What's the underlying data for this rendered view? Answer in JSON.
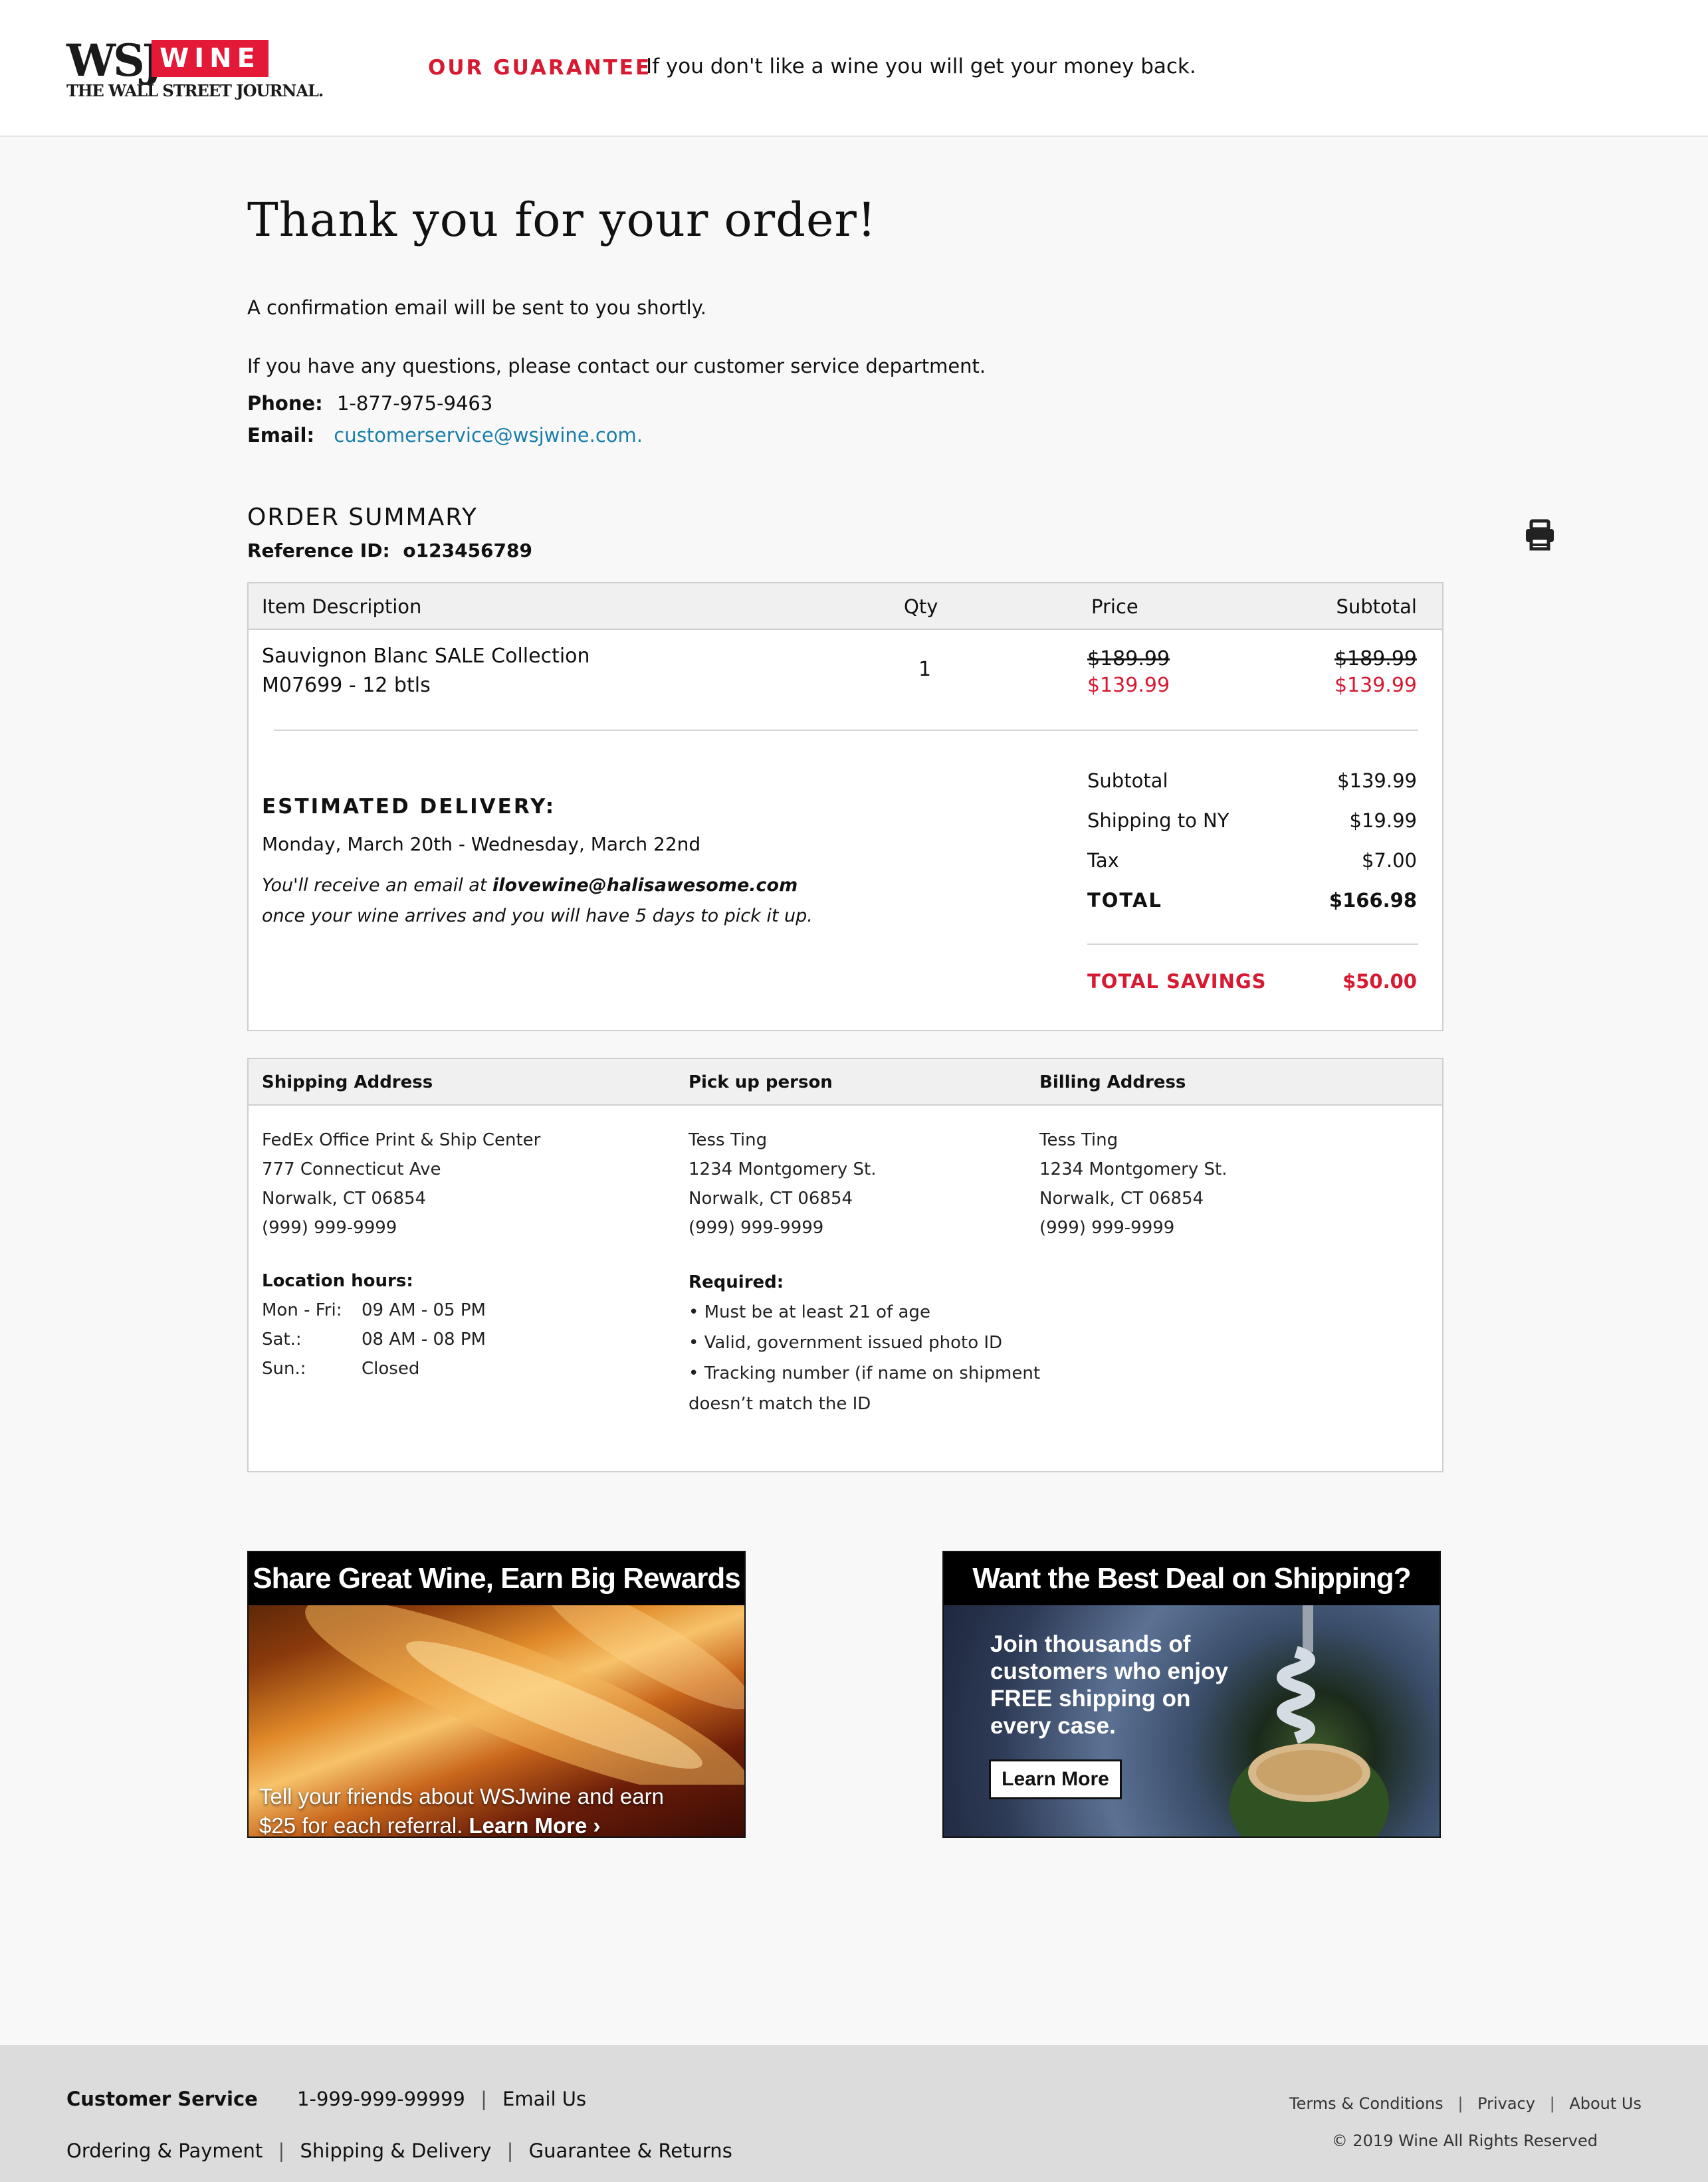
{
  "header": {
    "logo_wsj": "WSJ",
    "logo_wine": "WINE",
    "logo_journal": "THE WALL STREET JOURNAL.",
    "guarantee_label": "OUR GUARANTEE",
    "guarantee_text": "If you don't like a wine you will get your money back."
  },
  "intro": {
    "title": "Thank you for your order!",
    "confirmation": "A confirmation email will be sent to you shortly.",
    "questions": "If you have any questions, please contact our customer service department.",
    "phone_label": "Phone:",
    "phone": "1-877-975-9463",
    "email_label": "Email:",
    "email": "customerservice@wsjwine.com."
  },
  "summary": {
    "title": "ORDER SUMMARY",
    "reference_label": "Reference ID:",
    "reference_id": "o123456789",
    "print_icon": "printer-icon",
    "columns": {
      "description": "Item Description",
      "qty": "Qty",
      "price": "Price",
      "subtotal": "Subtotal"
    },
    "item": {
      "name": "Sauvignon Blanc SALE Collection",
      "code": "M07699 - 12 btls",
      "qty": "1",
      "price_original": "$189.99",
      "price_sale": "$139.99",
      "subtotal_original": "$189.99",
      "subtotal_sale": "$139.99"
    },
    "delivery": {
      "title": "ESTIMATED DELIVERY:",
      "dates": "Monday, March 20th - Wednesday, March 22nd",
      "note_before": "You'll receive an email at ",
      "note_email": "ilovewine@halisawesome.com",
      "note_after": " once your wine arrives and you will have 5 days to pick it up."
    },
    "totals": {
      "subtotal_label": "Subtotal",
      "subtotal": "$139.99",
      "shipping_label": "Shipping to NY",
      "shipping": "$19.99",
      "tax_label": "Tax",
      "tax": "$7.00",
      "total_label": "TOTAL",
      "total": "$166.98",
      "savings_label": "TOTAL SAVINGS",
      "savings": "$50.00"
    }
  },
  "addresses": {
    "shipping": {
      "heading": "Shipping Address",
      "lines": [
        "FedEx Office Print & Ship Center",
        "777 Connecticut Ave",
        "Norwalk, CT 06854",
        "(999) 999-9999"
      ],
      "hours_title": "Location hours:",
      "hours": [
        {
          "day": "Mon - Fri:",
          "time": "09 AM - 05 PM"
        },
        {
          "day": "Sat.:",
          "time": "08 AM - 08 PM"
        },
        {
          "day": "Sun.:",
          "time": "Closed"
        }
      ]
    },
    "pickup": {
      "heading": "Pick up person",
      "lines": [
        "Tess Ting",
        "1234 Montgomery St.",
        "Norwalk, CT 06854",
        "(999) 999-9999"
      ],
      "required_title": "Required:",
      "required": [
        "• Must be at least 21 of age",
        "• Valid, government issued photo ID",
        "• Tracking number (if name on shipment",
        "doesn’t match the ID"
      ]
    },
    "billing": {
      "heading": "Billing Address",
      "lines": [
        "Tess Ting",
        "1234 Montgomery St.",
        "Norwalk, CT 06854",
        "(999) 999-9999"
      ]
    }
  },
  "promos": {
    "referral": {
      "title": "Share Great Wine, Earn Big Rewards",
      "text_line1": "Tell your friends about WSJwine and earn",
      "text_line2": "$25 for each referral. ",
      "cta": "Learn More ›"
    },
    "shipping": {
      "title": "Want the Best Deal on Shipping?",
      "text": "Join thousands of customers who enjoy FREE shipping on every case.",
      "cta": "Learn More"
    }
  },
  "footer": {
    "customer_service": "Customer Service",
    "phone": "1-999-999-99999",
    "email_us": "Email Us",
    "links_left": [
      "Ordering & Payment",
      "Shipping & Delivery",
      "Guarantee & Returns"
    ],
    "links_right": [
      "Terms & Conditions",
      "Privacy",
      "About Us"
    ],
    "copyright": "© 2019 Wine All Rights Reserved"
  }
}
